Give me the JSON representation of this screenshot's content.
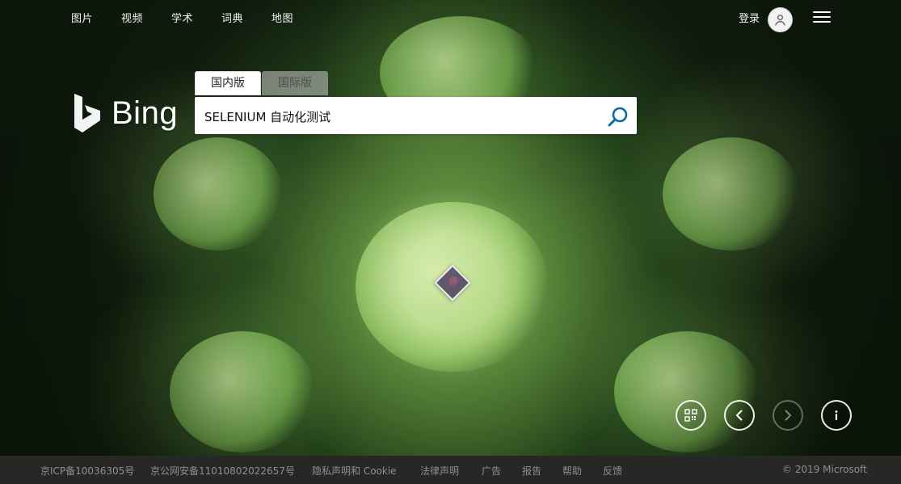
{
  "top_nav": {
    "images": "图片",
    "videos": "视频",
    "academic": "学术",
    "dictionary": "词典",
    "maps": "地图"
  },
  "account": {
    "signin_label": "登录",
    "avatar_icon": "user-icon",
    "menu_icon": "hamburger-menu-icon"
  },
  "logo": {
    "text": "Bing"
  },
  "search": {
    "tabs": [
      "国内版",
      "国际版"
    ],
    "active_tab": "国内版",
    "query": "SELENIUM 自动化测试",
    "search_icon": "search-icon",
    "colors": {
      "accent": "#0b6aa2"
    }
  },
  "controls": {
    "qr_icon": "qr-code-icon",
    "prev_icon": "chevron-left-icon",
    "next_icon": "chevron-right-icon",
    "info_icon": "info-icon"
  },
  "footer": {
    "icp": "京ICP备10036305号",
    "police": "京公网安备11010802022657号",
    "privacy": "隐私声明和 Cookie",
    "legal": "法律声明",
    "ads": "广告",
    "report": "报告",
    "help": "帮助",
    "feedback": "反馈",
    "copyright": "© 2019 Microsoft"
  }
}
